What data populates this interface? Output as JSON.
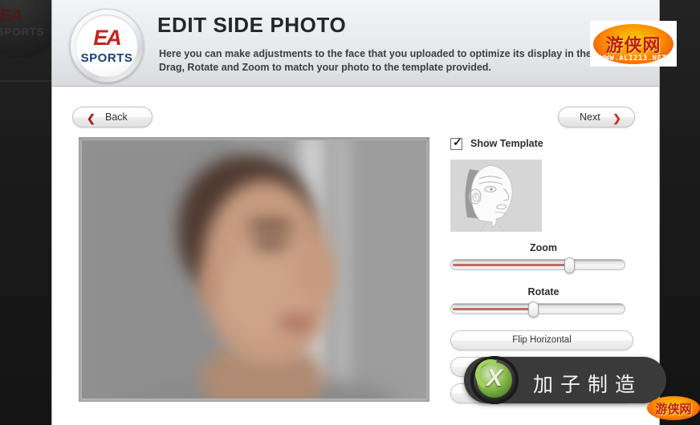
{
  "window": {
    "background_color": "#1a1a1a",
    "dialog_background": "#ffffff"
  },
  "background": {
    "ea_mark": "EA",
    "ea_sports": "SPORTS"
  },
  "header": {
    "title": "EDIT SIDE PHOTO",
    "description": "Here you can make adjustments to the face that you uploaded to optimize its display in the game. Drag, Rotate and Zoom to match your photo to the template provided.",
    "logo": {
      "mark": "EA",
      "sports": "SPORTS",
      "mark_color": "#c0261f",
      "sports_color": "#13417a"
    }
  },
  "nav": {
    "back_label": "Back",
    "back_chevron": "❮",
    "next_label": "Next",
    "next_chevron": "❯",
    "chevron_color": "#a51f1c"
  },
  "photo": {
    "name": "side-photo-preview",
    "state": "blurred-portrait"
  },
  "controls": {
    "show_template": {
      "label": "Show Template",
      "checked": true,
      "tick": "✓"
    },
    "template_thumbnail": {
      "name": "side-profile-face-template",
      "background_color": "#d6d6d6",
      "hair_color": "#9a9a9a",
      "face_color": "#fbfbfb"
    },
    "zoom": {
      "label": "Zoom",
      "value_percent": 69
    },
    "rotate": {
      "label": "Rotate",
      "value_percent": 47
    },
    "slider_fill_color": "#c06a66",
    "buttons": [
      {
        "label": "Flip Horizontal"
      },
      {
        "label": ""
      },
      {
        "label": ""
      }
    ]
  },
  "watermarks": {
    "top": {
      "chinese": "游侠网",
      "url": "WWW.ALI213.NET"
    },
    "bottom": {
      "chinese": "游侠网"
    },
    "overlay": {
      "text": "加子制造",
      "logo": "xbox-logo",
      "logo_glyph": "X"
    }
  }
}
